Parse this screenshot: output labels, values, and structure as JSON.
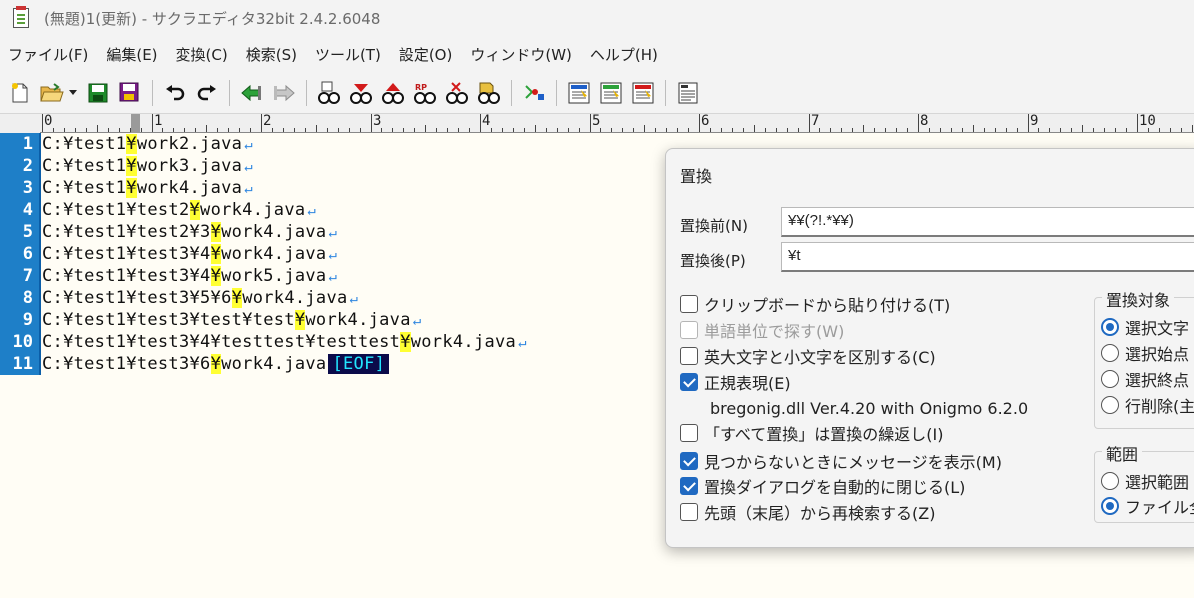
{
  "window": {
    "title": "(無題)1(更新) - サクラエディタ32bit 2.4.2.6048"
  },
  "menu": [
    "ファイル(F)",
    "編集(E)",
    "変換(C)",
    "検索(S)",
    "ツール(T)",
    "設定(O)",
    "ウィンドウ(W)",
    "ヘルプ(H)"
  ],
  "toolbar": {
    "icons": [
      "new-file-icon",
      "open-folder-icon",
      "save-icon",
      "save-all-icon",
      "undo-icon",
      "redo-icon",
      "jump-back-icon",
      "jump-forward-icon",
      "search-icon",
      "search-next-icon",
      "search-prev-icon",
      "replace-icon",
      "clear-mark-icon",
      "grep-icon",
      "bracket-jump-icon",
      "outline-icon",
      "type-setting-icon",
      "common-setting-icon",
      "document-list-icon"
    ]
  },
  "ruler": {
    "labels": [
      "0",
      "1",
      "2",
      "3",
      "4",
      "5",
      "6",
      "7",
      "8",
      "9",
      "10"
    ]
  },
  "editor": {
    "lines": [
      {
        "no": "1",
        "pre": "C:¥test1",
        "hl": "¥",
        "post": "work2.java",
        "ret": "↵",
        "eof": ""
      },
      {
        "no": "2",
        "pre": "C:¥test1",
        "hl": "¥",
        "post": "work3.java",
        "ret": "↵",
        "eof": ""
      },
      {
        "no": "3",
        "pre": "C:¥test1",
        "hl": "¥",
        "post": "work4.java",
        "ret": "↵",
        "eof": ""
      },
      {
        "no": "4",
        "pre": "C:¥test1¥test2",
        "hl": "¥",
        "post": "work4.java",
        "ret": "↵",
        "eof": ""
      },
      {
        "no": "5",
        "pre": "C:¥test1¥test2¥3",
        "hl": "¥",
        "post": "work4.java",
        "ret": "↵",
        "eof": ""
      },
      {
        "no": "6",
        "pre": "C:¥test1¥test3¥4",
        "hl": "¥",
        "post": "work4.java",
        "ret": "↵",
        "eof": ""
      },
      {
        "no": "7",
        "pre": "C:¥test1¥test3¥4",
        "hl": "¥",
        "post": "work5.java",
        "ret": "↵",
        "eof": ""
      },
      {
        "no": "8",
        "pre": "C:¥test1¥test3¥5¥6",
        "hl": "¥",
        "post": "work4.java",
        "ret": "↵",
        "eof": ""
      },
      {
        "no": "9",
        "pre": "C:¥test1¥test3¥test¥test",
        "hl": "¥",
        "post": "work4.java",
        "ret": "↵",
        "eof": ""
      },
      {
        "no": "10",
        "pre": "C:¥test1¥test3¥4¥testtest¥testtest",
        "hl": "¥",
        "post": "work4.java",
        "ret": "↵",
        "eof": ""
      },
      {
        "no": "11",
        "pre": "C:¥test1¥test3¥6",
        "hl": "¥",
        "post": "work4.java",
        "ret": "",
        "eof": "[EOF]"
      }
    ]
  },
  "dialog": {
    "title": "置換",
    "before_label": "置換前(N)",
    "before_value": "¥¥(?!.*¥¥)",
    "after_label": "置換後(P)",
    "after_value": "¥t",
    "options": {
      "paste_clipboard": "クリップボードから貼り付ける(T)",
      "word_unit": "単語単位で探す(W)",
      "case_sensitive": "英大文字と小文字を区別する(C)",
      "regex": "正規表現(E)",
      "replace_all_repeat": "「すべて置換」は置換の繰返し(I)",
      "message_not_found": "見つからないときにメッセージを表示(M)",
      "auto_close": "置換ダイアログを自動的に閉じる(L)",
      "search_from_top": "先頭（末尾）から再検索する(Z)"
    },
    "regex_info": "bregonig.dll Ver.4.20 with Onigmo 6.2.0",
    "target": {
      "title": "置換対象",
      "items": [
        "選択文字",
        "選択始点",
        "選択終点",
        "行削除(主"
      ]
    },
    "range": {
      "title": "範囲",
      "items": [
        "選択範囲",
        "ファイル全"
      ]
    }
  }
}
